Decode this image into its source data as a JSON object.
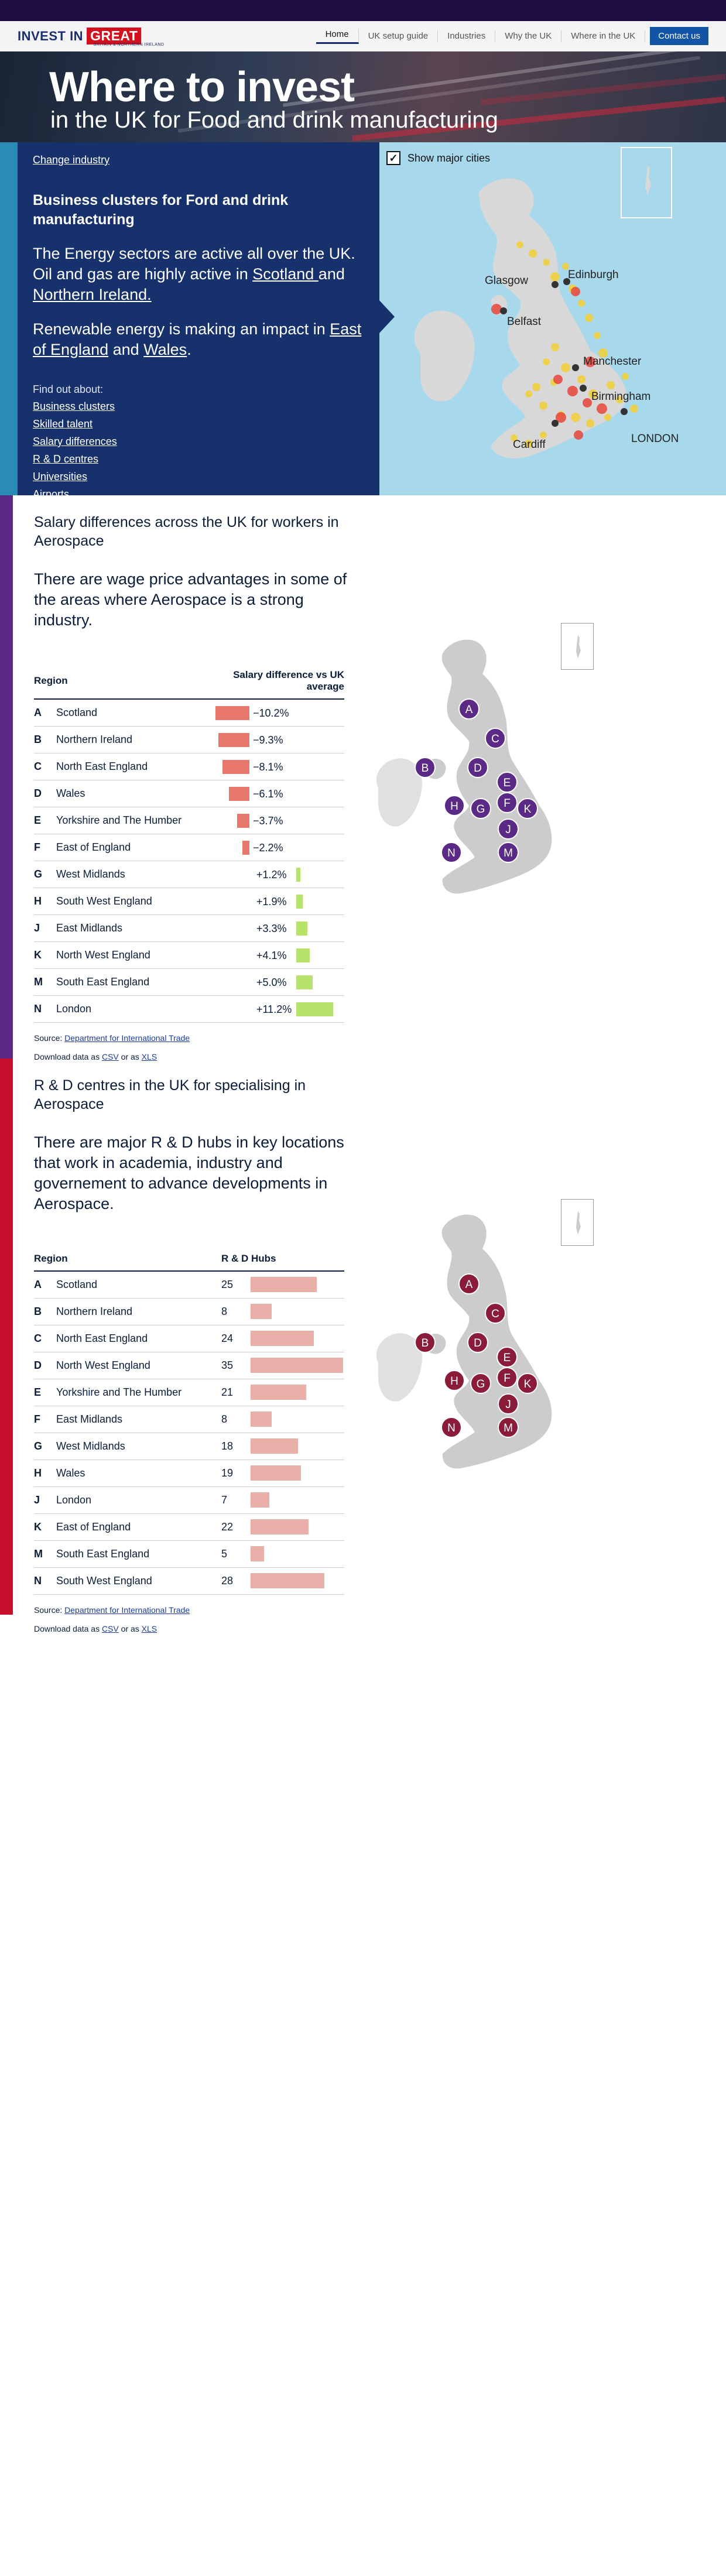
{
  "nav": {
    "logo_text": "INVEST IN",
    "logo_great": "GREAT",
    "logo_sub": "BRITAIN & NORTHERN IRELAND",
    "links": [
      "Home",
      "UK setup guide",
      "Industries",
      "Why the UK",
      "Where in the UK"
    ],
    "contact": "Contact us"
  },
  "hero": {
    "title": "Where to invest",
    "subtitle": "in the UK for Food and drink manufacturing"
  },
  "intro": {
    "change_industry": "Change industry",
    "heading": "Business clusters for Ford and drink manufacturing",
    "para1_prefix": "The Energy sectors are active all over the UK. Oil and gas are highly active in ",
    "para1_link1": "Scotland ",
    "para1_mid": "and ",
    "para1_link2": "Northern Ireland.",
    "para2_prefix": "Renewable energy is making an impact in ",
    "para2_link1": "East of England",
    "para2_mid": " and ",
    "para2_link2": "Wales",
    "para2_suffix": ".",
    "find_out": "Find out about:",
    "links": [
      "Business clusters",
      "Skilled talent",
      "Salary differences",
      "R & D centres",
      "Universities",
      "Airports"
    ],
    "show_cities_label": "Show major cities",
    "cities": [
      "Edinburgh",
      "Glasgow",
      "Belfast",
      "Manchester",
      "Birmingham",
      "Cardiff",
      "LONDON"
    ],
    "colors": {
      "accent": "#2a8bb5",
      "panel": "#16316b",
      "sea": "#a8d8ec"
    }
  },
  "salary": {
    "heading": "Salary differences across the UK for workers in Aerospace",
    "lead": "There are wage price advantages in some of the areas where Aerospace is a strong industry.",
    "col_region": "Region",
    "col_value": "Salary difference vs UK average",
    "rows": [
      {
        "letter": "A",
        "region": "Scotland",
        "label": "−10.2%",
        "value": -10.2
      },
      {
        "letter": "B",
        "region": "Northern Ireland",
        "label": "−9.3%",
        "value": -9.3
      },
      {
        "letter": "C",
        "region": "North East England",
        "label": "−8.1%",
        "value": -8.1
      },
      {
        "letter": "D",
        "region": "Wales",
        "label": "−6.1%",
        "value": -6.1
      },
      {
        "letter": "E",
        "region": "Yorkshire and The Humber",
        "label": "−3.7%",
        "value": -3.7
      },
      {
        "letter": "F",
        "region": "East of England",
        "label": "−2.2%",
        "value": -2.2
      },
      {
        "letter": "G",
        "region": "West Midlands",
        "label": "+1.2%",
        "value": 1.2
      },
      {
        "letter": "H",
        "region": "South West England",
        "label": "+1.9%",
        "value": 1.9
      },
      {
        "letter": "J",
        "region": "East Midlands",
        "label": "+3.3%",
        "value": 3.3
      },
      {
        "letter": "K",
        "region": "North West England",
        "label": "+4.1%",
        "value": 4.1
      },
      {
        "letter": "M",
        "region": "South East England",
        "label": "+5.0%",
        "value": 5.0
      },
      {
        "letter": "N",
        "region": "London",
        "label": "+11.2%",
        "value": 11.2
      }
    ],
    "source_prefix": "Source: ",
    "source_link": "Department for International Trade",
    "download_prefix": "Download data as ",
    "download_csv": "CSV",
    "download_mid": " or as ",
    "download_xls": "XLS",
    "colors": {
      "accent": "#5b2a86",
      "negative": "#e8786e",
      "positive": "#b7e36a",
      "marker": "#5b2a86"
    }
  },
  "rd": {
    "heading": "R & D centres in the UK for specialising in Aerospace",
    "lead": "There are major R & D hubs in key locations that work in academia, industry and governement to advance developments in Aerospace.",
    "col_region": "Region",
    "col_value": "R & D Hubs",
    "rows": [
      {
        "letter": "A",
        "region": "Scotland",
        "value": 25
      },
      {
        "letter": "B",
        "region": "Northern Ireland",
        "value": 8
      },
      {
        "letter": "C",
        "region": "North East England",
        "value": 24
      },
      {
        "letter": "D",
        "region": "North West England",
        "value": 35
      },
      {
        "letter": "E",
        "region": "Yorkshire and The Humber",
        "value": 21
      },
      {
        "letter": "F",
        "region": "East Midlands",
        "value": 8
      },
      {
        "letter": "G",
        "region": "West Midlands",
        "value": 18
      },
      {
        "letter": "H",
        "region": "Wales",
        "value": 19
      },
      {
        "letter": "J",
        "region": "London",
        "value": 7
      },
      {
        "letter": "K",
        "region": "East of England",
        "value": 22
      },
      {
        "letter": "M",
        "region": "South East England",
        "value": 5
      },
      {
        "letter": "N",
        "region": "South West England",
        "value": 28
      }
    ],
    "source_prefix": "Source: ",
    "source_link": "Department for International Trade",
    "download_prefix": "Download data as ",
    "download_csv": "CSV",
    "download_mid": " or as ",
    "download_xls": "XLS",
    "colors": {
      "accent": "#c8102e",
      "bar": "#e8b0a8",
      "marker": "#8a1c3a"
    }
  }
}
